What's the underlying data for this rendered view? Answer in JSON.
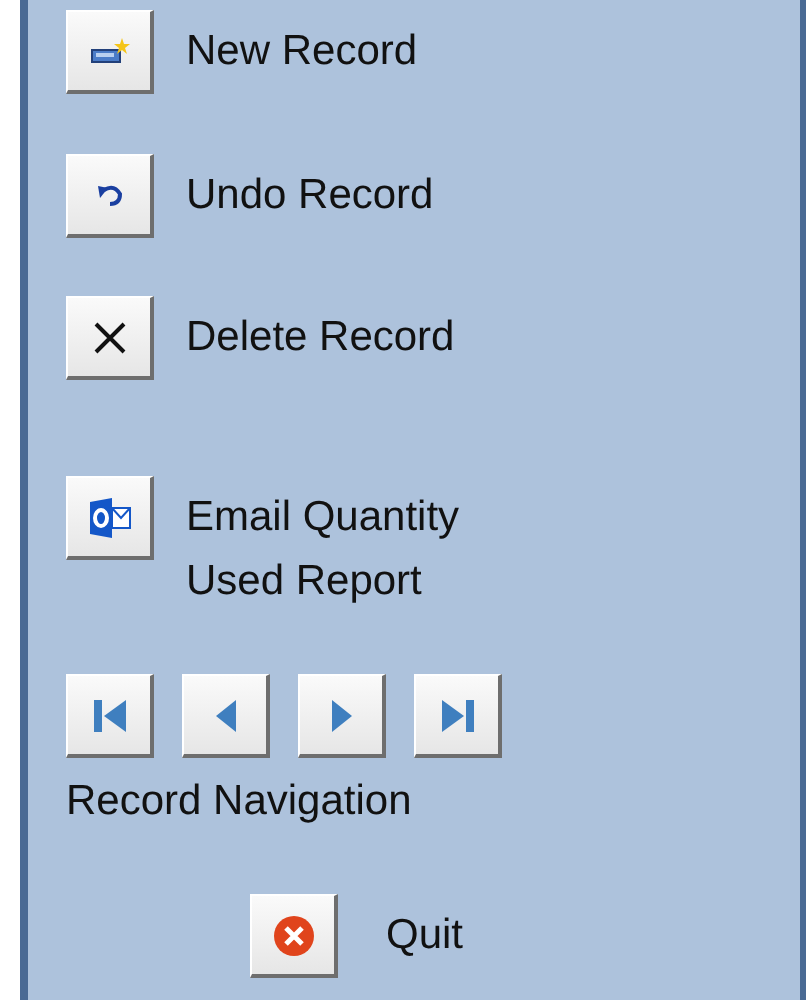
{
  "actions": [
    {
      "kind": "new",
      "label": "New Record"
    },
    {
      "kind": "undo",
      "label": "Undo Record"
    },
    {
      "kind": "delete",
      "label": "Delete Record"
    },
    {
      "kind": "email",
      "label": "Email Quantity Used Report"
    }
  ],
  "navigation": {
    "buttons": [
      {
        "kind": "first"
      },
      {
        "kind": "previous"
      },
      {
        "kind": "next"
      },
      {
        "kind": "last"
      }
    ],
    "label": "Record Navigation"
  },
  "quit": {
    "label": "Quit"
  }
}
